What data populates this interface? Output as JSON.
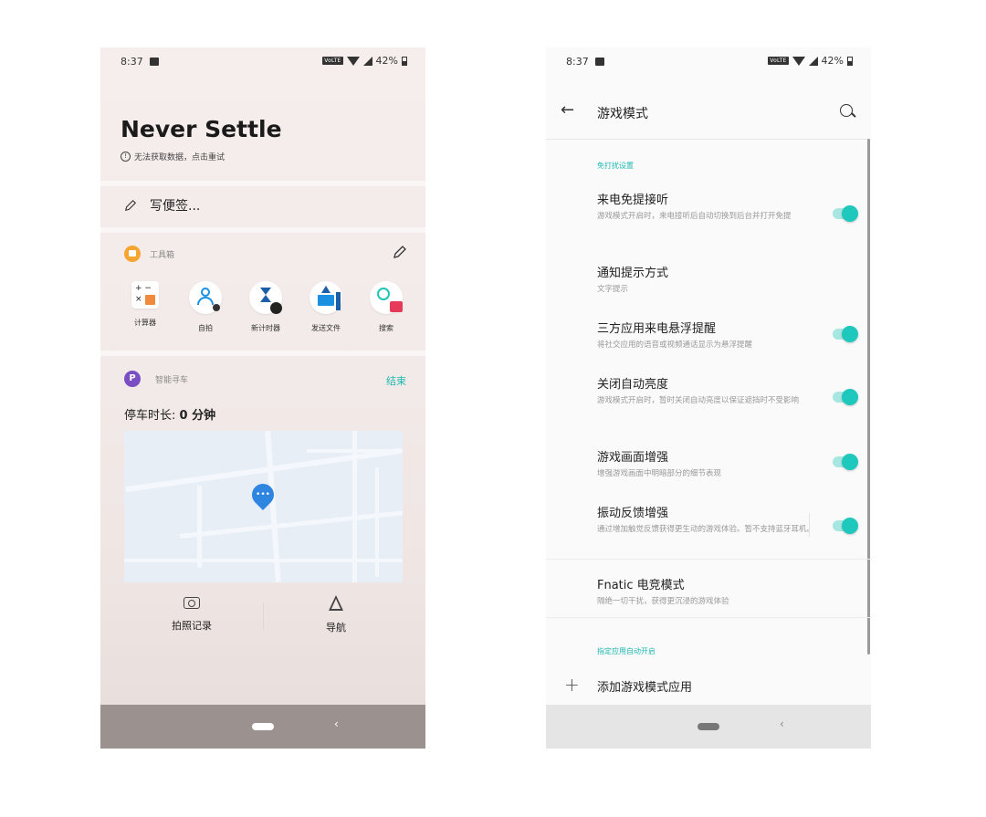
{
  "left": {
    "status": {
      "time": "8:37",
      "volte": "VoLTE",
      "battery": "42%"
    },
    "header_title": "Never Settle",
    "error_text": "无法获取数据，点击重试",
    "note_placeholder": "写便签...",
    "toolbox_title": "工具箱",
    "tools": [
      {
        "label": "计算器",
        "icon": "calculator-icon"
      },
      {
        "label": "自拍",
        "icon": "selfie-icon"
      },
      {
        "label": "新计时器",
        "icon": "timer-icon"
      },
      {
        "label": "发送文件",
        "icon": "send-file-icon"
      },
      {
        "label": "搜索",
        "icon": "search-icon"
      }
    ],
    "parking_title": "智能寻车",
    "parking_end": "结束",
    "parking_time_label": "停车时长: ",
    "parking_time_value": "0 分钟",
    "photo_label": "拍照记录",
    "navigate_label": "导航",
    "map_pin_dots": "•••",
    "calc_symbols": "+ −\n×"
  },
  "right": {
    "status": {
      "time": "8:37",
      "volte": "VoLTE",
      "battery": "42%"
    },
    "title": "游戏模式",
    "section1": "免打扰设置",
    "items": [
      {
        "title": "来电免提接听",
        "subtitle": "游戏模式开启时，来电接听后自动切换到后台并打开免提",
        "toggle": true
      },
      {
        "title": "通知提示方式",
        "subtitle": "文字提示",
        "toggle": false
      },
      {
        "title": "三方应用来电悬浮提醒",
        "subtitle": "将社交应用的语音或视频通话显示为悬浮提醒",
        "toggle": true
      },
      {
        "title": "关闭自动亮度",
        "subtitle": "游戏模式开启时，暂时关闭自动亮度以保证遮挡时不受影响",
        "toggle": true
      },
      {
        "title": "游戏画面增强",
        "subtitle": "增强游戏画面中明暗部分的细节表现",
        "toggle": true
      },
      {
        "title": "振动反馈增强",
        "subtitle": "通过增加触觉反馈获得更生动的游戏体验。暂不支持蓝牙耳机。",
        "toggle": true
      },
      {
        "title": "Fnatic 电竞模式",
        "subtitle": "隔绝一切干扰，获得更沉浸的游戏体验",
        "toggle": false
      }
    ],
    "section2": "指定应用自动开启",
    "add_app": "添加游戏模式应用",
    "accent_color": "#1fc8bd"
  }
}
